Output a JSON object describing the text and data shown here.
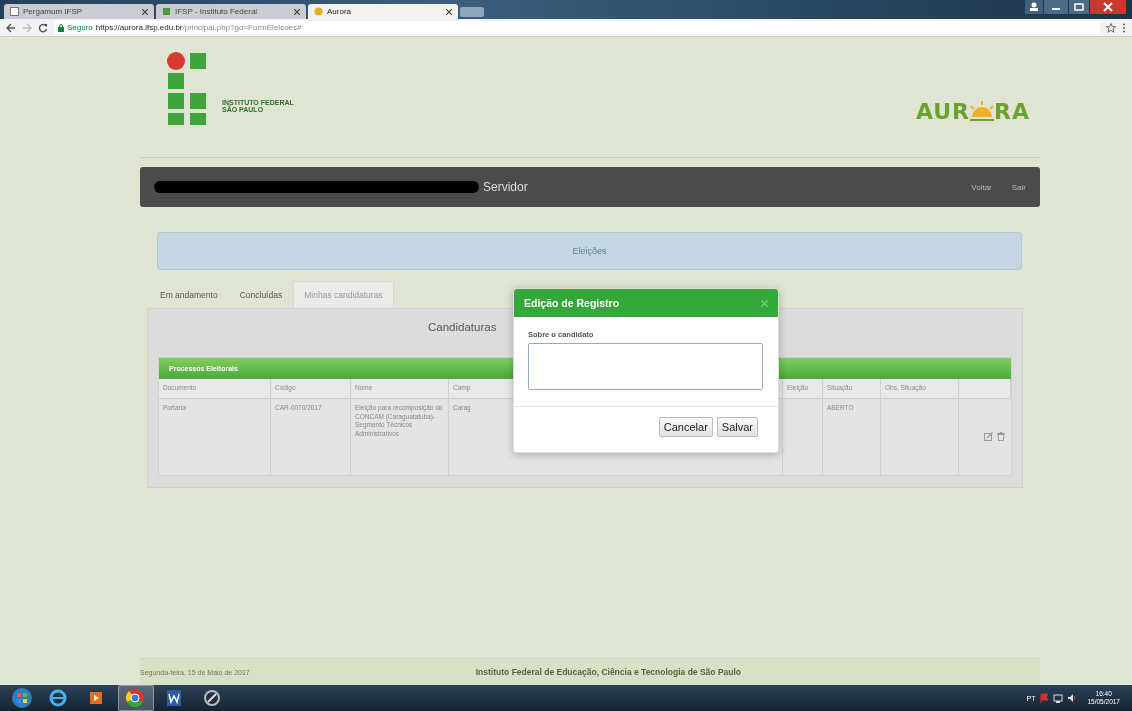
{
  "browser": {
    "tabs": [
      {
        "title": "Pergamum IFSP",
        "selected": false
      },
      {
        "title": "IFSP - Instituto Federal",
        "selected": false
      },
      {
        "title": "Aurora",
        "selected": true
      }
    ],
    "security_label": "Seguro",
    "url_host": "https://aurora.ifsp.edu.br",
    "url_path": "/principal.php?go=FormEleicoes#"
  },
  "header": {
    "institute_line_1": "INSTITUTO FEDERAL",
    "institute_line_2": "SÃO PAULO",
    "app_logo_start": "AUR",
    "app_logo_end": "RA"
  },
  "user_bar": {
    "role": "Servidor",
    "links": [
      "Voltar",
      "Sair"
    ]
  },
  "section_title": "Eleições",
  "tabs": [
    {
      "label": "Em andamento",
      "selected": false
    },
    {
      "label": "Concluídas",
      "selected": false
    },
    {
      "label": "Minhas candidaturas",
      "selected": true
    }
  ],
  "panel_title": "Candidaturas",
  "table": {
    "title": "Processos Eleitorais",
    "columns": [
      "Documento",
      "Código",
      "Nome",
      "Camp",
      "Eleição",
      "Situação",
      "Obs. Situação"
    ],
    "rows": [
      {
        "cells": [
          "Portaria",
          "CAR-0070/2017",
          "Eleição para recomposição do CONCAM (Caraguatatuba)- Segmento Técnicos Administrativos",
          "Carag",
          null,
          "ABERTO",
          null
        ]
      }
    ]
  },
  "dialog": {
    "title": "Edição de Registro",
    "field_label": "Sobre o candidato",
    "buttons": [
      "Cancelar",
      "Salvar"
    ]
  },
  "footer": {
    "date": "Segunda-feira, 15 de Maio de 2017",
    "institution": "Instituto Federal de Educação, Ciência e Tecnologia de São Paulo"
  },
  "taskbar": {
    "language": "PT",
    "time": "16:40",
    "date": "15/05/2017"
  }
}
